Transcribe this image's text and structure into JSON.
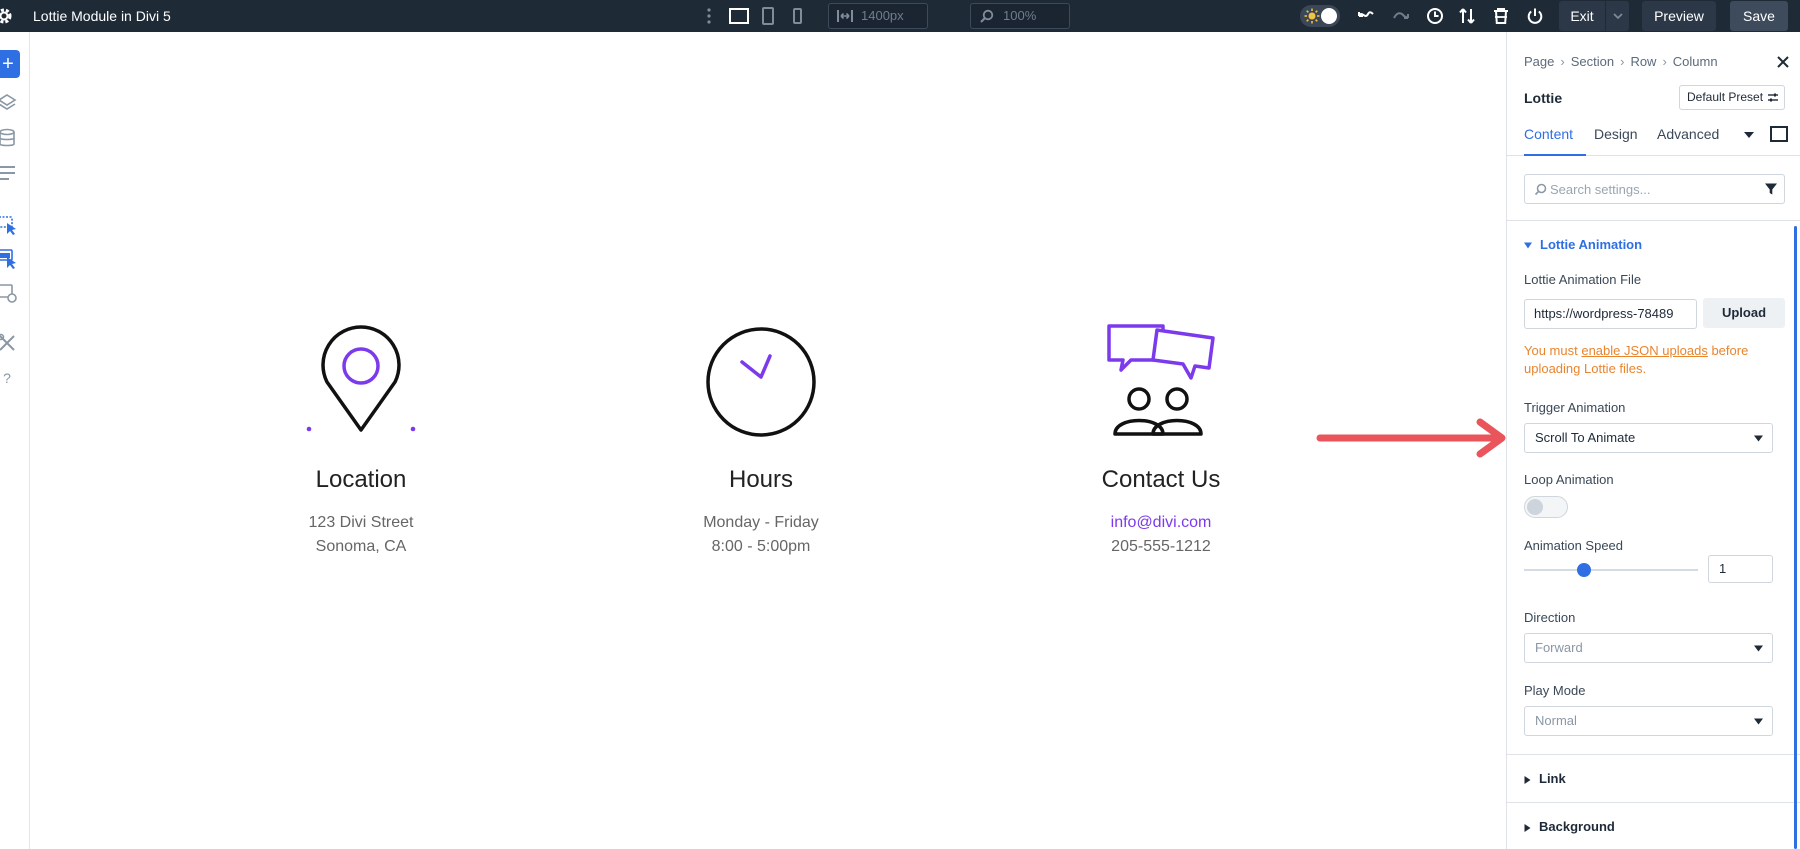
{
  "topbar": {
    "title": "Lottie Module in Divi 5",
    "width_value": "1400px",
    "zoom_value": "100%",
    "exit_label": "Exit",
    "preview_label": "Preview",
    "save_label": "Save"
  },
  "columns": [
    {
      "icon": "map-pin-icon",
      "heading": "Location",
      "line1": "123 Divi Street",
      "line2": "Sonoma, CA"
    },
    {
      "icon": "clock-icon",
      "heading": "Hours",
      "line1": "Monday - Friday",
      "line2": "8:00 - 5:00pm"
    },
    {
      "icon": "chat-people-icon",
      "heading": "Contact Us",
      "line1": "info@divi.com",
      "line2": "205-555-1212"
    }
  ],
  "panel": {
    "breadcrumbs": [
      "Page",
      "Section",
      "Row",
      "Column"
    ],
    "module_title": "Lottie",
    "preset_label": "Default Preset",
    "tabs": [
      "Content",
      "Design",
      "Advanced"
    ],
    "search_placeholder": "Search settings...",
    "section_title": "Lottie Animation",
    "file_label": "Lottie Animation File",
    "file_value": "https://wordpress-78489",
    "upload_label": "Upload",
    "warning_prefix": "You must ",
    "warning_link": "enable JSON uploads",
    "warning_suffix": " before uploading Lottie files.",
    "trigger_label": "Trigger Animation",
    "trigger_value": "Scroll To Animate",
    "loop_label": "Loop Animation",
    "loop_on": false,
    "speed_label": "Animation Speed",
    "speed_value": "1",
    "speed_fraction": 0.33,
    "direction_label": "Direction",
    "direction_value": "Forward",
    "playmode_label": "Play Mode",
    "playmode_value": "Normal",
    "link_section": "Link",
    "background_section": "Background"
  },
  "colors": {
    "accent": "#2f6fe4",
    "purple": "#7c3aed",
    "arrow": "#e9555a",
    "warning": "#e8852f",
    "topbar": "#1f2a37"
  }
}
